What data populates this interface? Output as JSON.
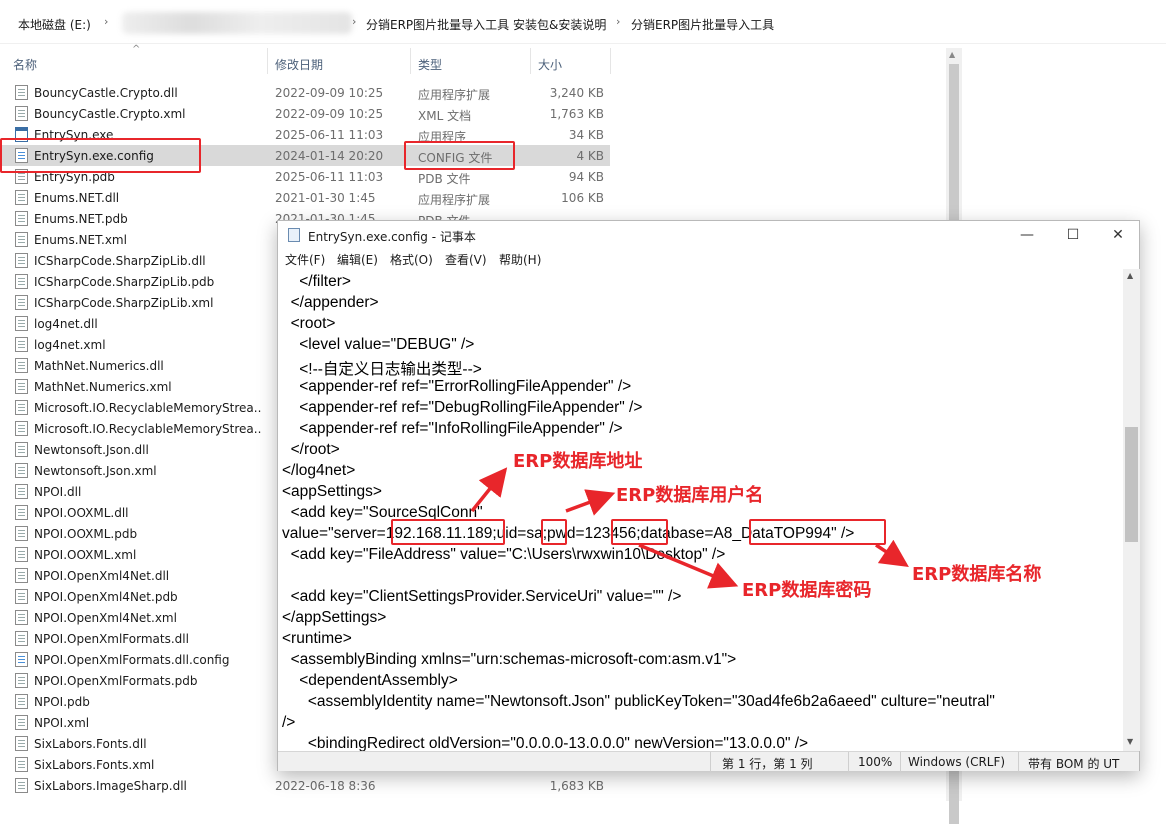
{
  "breadcrumb": {
    "drive": "本地磁盘 (E:)",
    "folder1": "分销ERP图片批量导入工具 安装包&安装说明",
    "folder2": "分销ERP图片批量导入工具"
  },
  "columns": {
    "name": "名称",
    "date": "修改日期",
    "type": "类型",
    "size": "大小"
  },
  "files": [
    {
      "name": "BouncyCastle.Crypto.dll",
      "date": "2022-09-09 10:25",
      "type": "应用程序扩展",
      "size": "3,240 KB",
      "icon": "dll-icon"
    },
    {
      "name": "BouncyCastle.Crypto.xml",
      "date": "2022-09-09 10:25",
      "type": "XML 文档",
      "size": "1,763 KB",
      "icon": "file-icon"
    },
    {
      "name": "EntrySyn.exe",
      "date": "2025-06-11 11:03",
      "type": "应用程序",
      "size": "34 KB",
      "icon": "exe-icon"
    },
    {
      "name": "EntrySyn.exe.config",
      "date": "2024-01-14 20:20",
      "type": "CONFIG 文件",
      "size": "4 KB",
      "icon": "config-icon",
      "selected": true
    },
    {
      "name": "EntrySyn.pdb",
      "date": "2025-06-11 11:03",
      "type": "PDB 文件",
      "size": "94 KB",
      "icon": "file-icon"
    },
    {
      "name": "Enums.NET.dll",
      "date": "2021-01-30 1:45",
      "type": "应用程序扩展",
      "size": "106 KB",
      "icon": "dll-icon"
    },
    {
      "name": "Enums.NET.pdb",
      "date": "2021-01-30 1:45",
      "type": "PDB 文件",
      "size": "",
      "icon": "file-icon"
    },
    {
      "name": "Enums.NET.xml",
      "date": "",
      "type": "",
      "size": "",
      "icon": "file-icon"
    },
    {
      "name": "ICSharpCode.SharpZipLib.dll",
      "date": "",
      "type": "",
      "size": "",
      "icon": "dll-icon"
    },
    {
      "name": "ICSharpCode.SharpZipLib.pdb",
      "date": "",
      "type": "",
      "size": "",
      "icon": "file-icon"
    },
    {
      "name": "ICSharpCode.SharpZipLib.xml",
      "date": "",
      "type": "",
      "size": "",
      "icon": "file-icon"
    },
    {
      "name": "log4net.dll",
      "date": "",
      "type": "",
      "size": "",
      "icon": "dll-icon"
    },
    {
      "name": "log4net.xml",
      "date": "",
      "type": "",
      "size": "",
      "icon": "file-icon"
    },
    {
      "name": "MathNet.Numerics.dll",
      "date": "",
      "type": "",
      "size": "",
      "icon": "dll-icon"
    },
    {
      "name": "MathNet.Numerics.xml",
      "date": "",
      "type": "",
      "size": "",
      "icon": "file-icon"
    },
    {
      "name": "Microsoft.IO.RecyclableMemoryStrea...",
      "date": "",
      "type": "",
      "size": "",
      "icon": "dll-icon"
    },
    {
      "name": "Microsoft.IO.RecyclableMemoryStrea...",
      "date": "",
      "type": "",
      "size": "",
      "icon": "file-icon"
    },
    {
      "name": "Newtonsoft.Json.dll",
      "date": "",
      "type": "",
      "size": "",
      "icon": "dll-icon"
    },
    {
      "name": "Newtonsoft.Json.xml",
      "date": "",
      "type": "",
      "size": "",
      "icon": "file-icon"
    },
    {
      "name": "NPOI.dll",
      "date": "",
      "type": "",
      "size": "",
      "icon": "dll-icon"
    },
    {
      "name": "NPOI.OOXML.dll",
      "date": "",
      "type": "",
      "size": "",
      "icon": "dll-icon"
    },
    {
      "name": "NPOI.OOXML.pdb",
      "date": "",
      "type": "",
      "size": "",
      "icon": "file-icon"
    },
    {
      "name": "NPOI.OOXML.xml",
      "date": "",
      "type": "",
      "size": "",
      "icon": "file-icon"
    },
    {
      "name": "NPOI.OpenXml4Net.dll",
      "date": "",
      "type": "",
      "size": "",
      "icon": "dll-icon"
    },
    {
      "name": "NPOI.OpenXml4Net.pdb",
      "date": "",
      "type": "",
      "size": "",
      "icon": "file-icon"
    },
    {
      "name": "NPOI.OpenXml4Net.xml",
      "date": "",
      "type": "",
      "size": "",
      "icon": "file-icon"
    },
    {
      "name": "NPOI.OpenXmlFormats.dll",
      "date": "",
      "type": "",
      "size": "",
      "icon": "dll-icon"
    },
    {
      "name": "NPOI.OpenXmlFormats.dll.config",
      "date": "",
      "type": "",
      "size": "",
      "icon": "config-icon"
    },
    {
      "name": "NPOI.OpenXmlFormats.pdb",
      "date": "",
      "type": "",
      "size": "",
      "icon": "file-icon"
    },
    {
      "name": "NPOI.pdb",
      "date": "",
      "type": "",
      "size": "",
      "icon": "file-icon"
    },
    {
      "name": "NPOI.xml",
      "date": "",
      "type": "",
      "size": "",
      "icon": "file-icon"
    },
    {
      "name": "SixLabors.Fonts.dll",
      "date": "",
      "type": "",
      "size": "",
      "icon": "dll-icon"
    },
    {
      "name": "SixLabors.Fonts.xml",
      "date": "",
      "type": "",
      "size": "",
      "icon": "file-icon"
    },
    {
      "name": "SixLabors.ImageSharp.dll",
      "date": "2022-06-18 8:36",
      "type": "",
      "size": "1,683 KB",
      "icon": "dll-icon"
    }
  ],
  "notepad": {
    "title": "EntrySyn.exe.config - 记事本",
    "menu": [
      "文件(F)",
      "编辑(E)",
      "格式(O)",
      "查看(V)",
      "帮助(H)"
    ],
    "lines": [
      "    </filter>",
      "  </appender>",
      "  <root>",
      "    <level value=\"DEBUG\" />",
      "    <!--自定义日志输出类型-->",
      "    <appender-ref ref=\"ErrorRollingFileAppender\" />",
      "    <appender-ref ref=\"DebugRollingFileAppender\" />",
      "    <appender-ref ref=\"InfoRollingFileAppender\" />",
      "  </root>",
      "</log4net>",
      "<appSettings>",
      "  <add key=\"SourceSqlConn\"",
      "value=\"server=192.168.11.189;uid=sa;pwd=123456;database=A8_DataTOP994\" />",
      "  <add key=\"FileAddress\" value=\"C:\\Users\\rwxwin10\\Desktop\" />",
      "",
      "  <add key=\"ClientSettingsProvider.ServiceUri\" value=\"\" />",
      "</appSettings>",
      "<runtime>",
      "  <assemblyBinding xmlns=\"urn:schemas-microsoft-com:asm.v1\">",
      "    <dependentAssembly>",
      "      <assemblyIdentity name=\"Newtonsoft.Json\" publicKeyToken=\"30ad4fe6b2a6aeed\" culture=\"neutral\"",
      "/>",
      "      <bindingRedirect oldVersion=\"0.0.0.0-13.0.0.0\" newVersion=\"13.0.0.0\" />"
    ],
    "status": {
      "position": "第 1 行，第 1 列",
      "zoom": "100%",
      "eol": "Windows (CRLF)",
      "encoding": "带有 BOM 的 UT"
    }
  },
  "annotations": {
    "server": "ERP数据库地址",
    "user": "ERP数据库用户名",
    "password": "ERP数据库密码",
    "database": "ERP数据库名称"
  },
  "colors": {
    "accent_red": "#e8262b",
    "selection": "#d9d9d9"
  }
}
